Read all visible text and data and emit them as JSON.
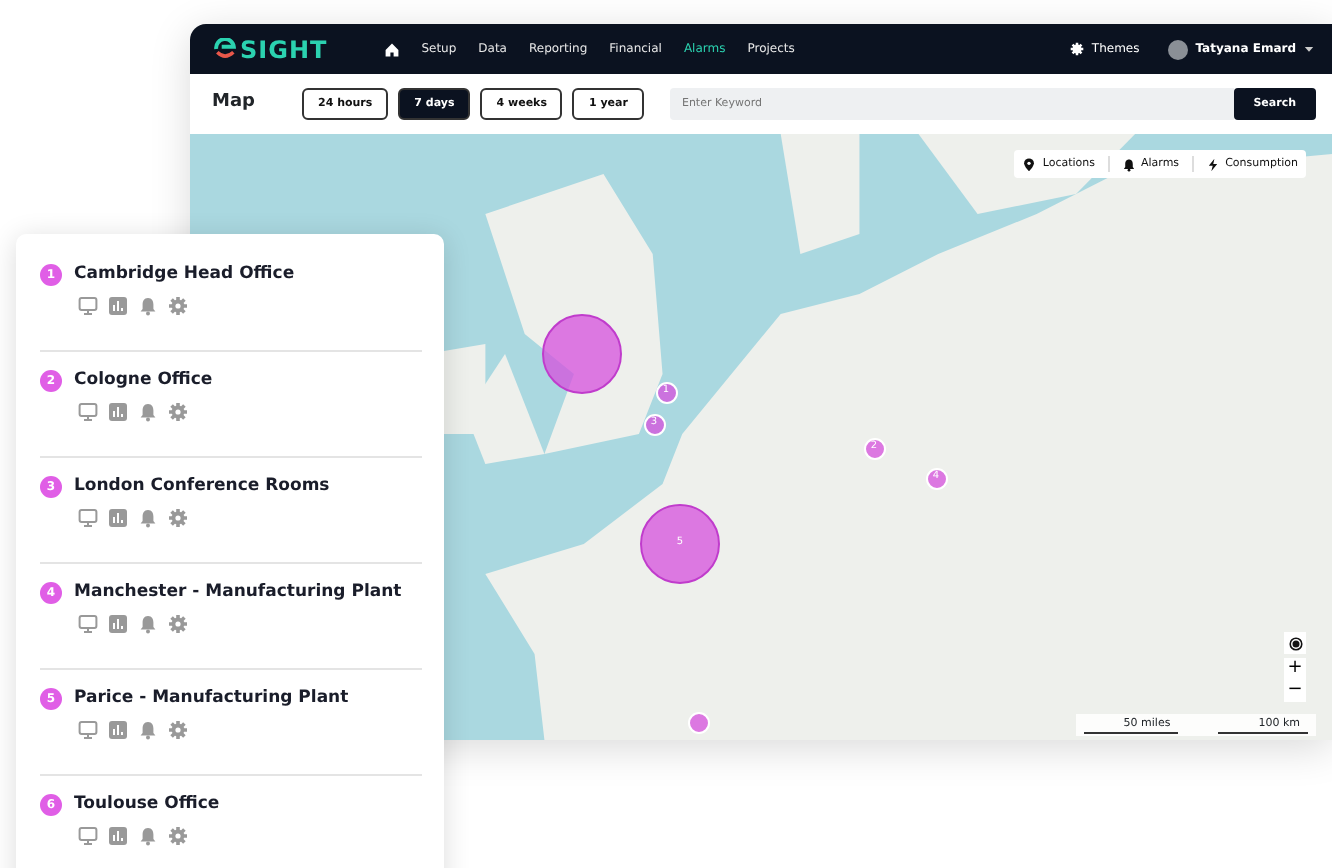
{
  "app": {
    "logo": "SIGHT",
    "nav": [
      {
        "label": "Setup",
        "selected": false
      },
      {
        "label": "Data",
        "selected": false
      },
      {
        "label": "Reporting",
        "selected": false
      },
      {
        "label": "Financial",
        "selected": false
      },
      {
        "label": "Alarms",
        "selected": true
      },
      {
        "label": "Projects",
        "selected": false
      }
    ],
    "themes": "Themes",
    "user": "Tatyana Emard"
  },
  "toolbar": {
    "title": "Map",
    "ranges": [
      {
        "label": "24 hours",
        "selected": false
      },
      {
        "label": "7 days",
        "selected": true
      },
      {
        "label": "4 weeks",
        "selected": false
      },
      {
        "label": "1 year",
        "selected": false
      }
    ],
    "search": {
      "placeholder": "Enter Keyword",
      "button": "Search"
    }
  },
  "map": {
    "layers": [
      "Locations",
      "Alarms",
      "Consumption"
    ],
    "markers": [
      {
        "kind": "large"
      },
      {
        "label": "1",
        "kind": "small"
      },
      {
        "label": "3",
        "kind": "small"
      },
      {
        "label": "2",
        "kind": "small"
      },
      {
        "label": "4",
        "kind": "small"
      },
      {
        "label": "5",
        "kind": "large"
      },
      {
        "kind": "small"
      }
    ],
    "zoom_in": "+",
    "zoom_out": "−",
    "scale": [
      "50 miles",
      "100 km"
    ]
  },
  "locations": [
    {
      "number": "1",
      "name": "Cambridge Head Office"
    },
    {
      "number": "2",
      "name": "Cologne Office"
    },
    {
      "number": "3",
      "name": "London Conference Rooms"
    },
    {
      "number": "4",
      "name": "Manchester - Manufacturing Plant"
    },
    {
      "number": "5",
      "name": "Parice - Manufacturing Plant"
    },
    {
      "number": "6",
      "name": "Toulouse Office"
    }
  ]
}
